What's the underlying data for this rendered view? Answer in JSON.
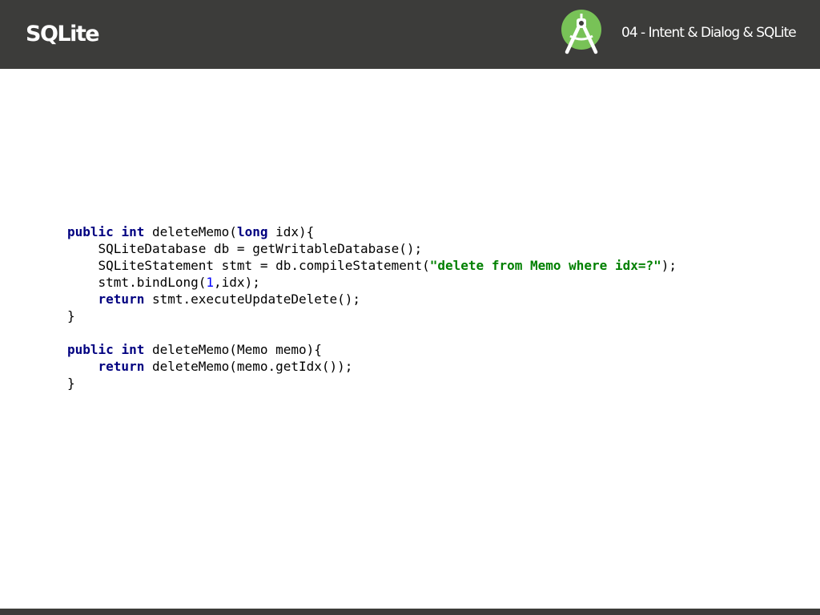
{
  "header": {
    "title": "SQLite",
    "subtitle": "04 - Intent & Dialog & SQLite",
    "logo_icon": "android-studio-icon",
    "background_color": "#3c3c3a",
    "logo_color": "#78c257"
  },
  "code": {
    "lines": [
      [
        {
          "t": "public",
          "c": "kw"
        },
        {
          "t": " "
        },
        {
          "t": "int",
          "c": "kw"
        },
        {
          "t": " deleteMemo("
        },
        {
          "t": "long",
          "c": "kw"
        },
        {
          "t": " idx){"
        }
      ],
      [
        {
          "t": "    SQLiteDatabase db = getWritableDatabase();"
        }
      ],
      [
        {
          "t": "    SQLiteStatement stmt = db.compileStatement("
        },
        {
          "t": "\"delete from Memo where idx=?\"",
          "c": "str"
        },
        {
          "t": ");"
        }
      ],
      [
        {
          "t": "    stmt.bindLong("
        },
        {
          "t": "1",
          "c": "num"
        },
        {
          "t": ",idx);"
        }
      ],
      [
        {
          "t": "    "
        },
        {
          "t": "return",
          "c": "kw"
        },
        {
          "t": " stmt.executeUpdateDelete();"
        }
      ],
      [
        {
          "t": "}"
        }
      ],
      [
        {
          "t": ""
        }
      ],
      [
        {
          "t": "public",
          "c": "kw"
        },
        {
          "t": " "
        },
        {
          "t": "int",
          "c": "kw"
        },
        {
          "t": " deleteMemo(Memo memo){"
        }
      ],
      [
        {
          "t": "    "
        },
        {
          "t": "return",
          "c": "kw"
        },
        {
          "t": " deleteMemo(memo.getIdx());"
        }
      ],
      [
        {
          "t": "}"
        }
      ]
    ]
  }
}
